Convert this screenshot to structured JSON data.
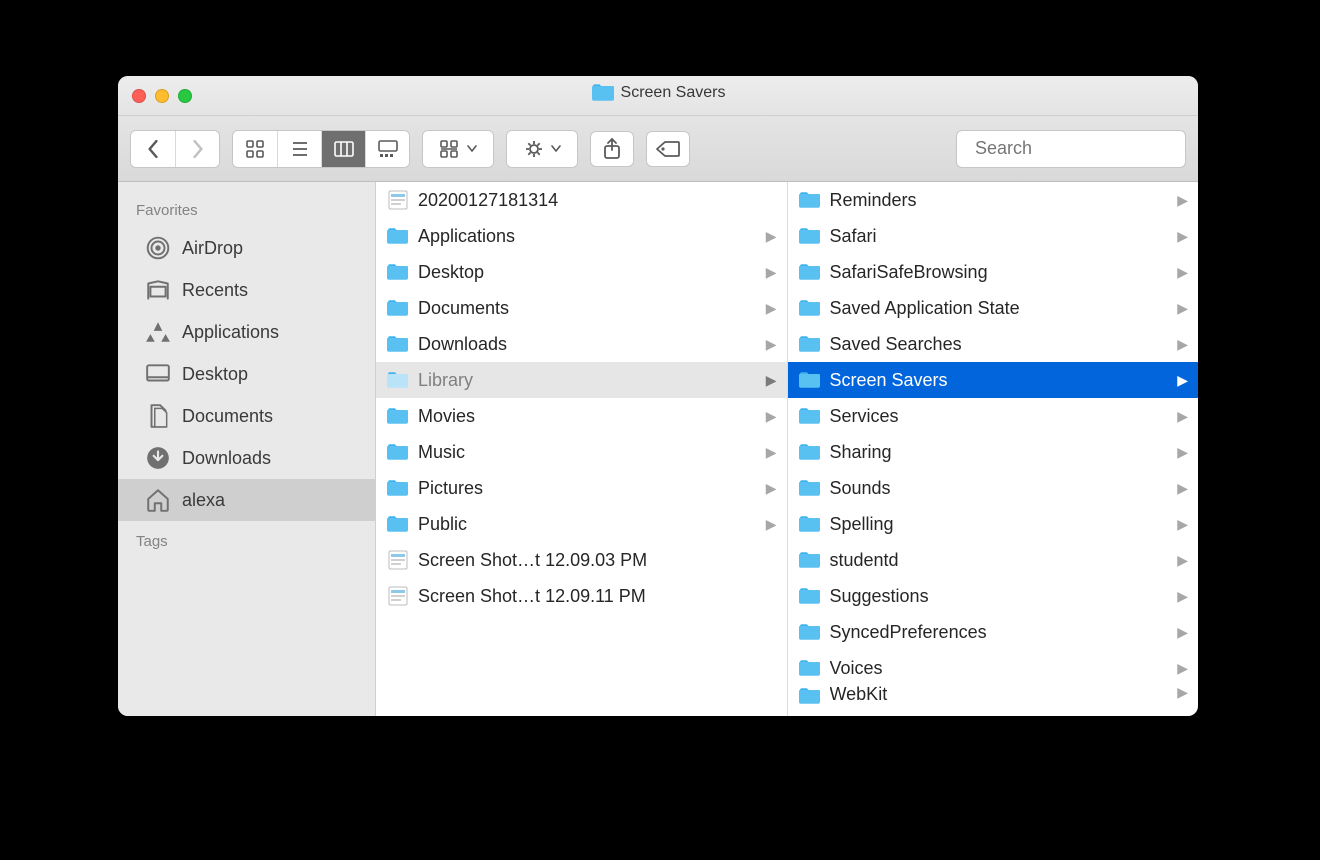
{
  "window": {
    "title": "Screen Savers",
    "titleIconColor": "#59c1f1"
  },
  "toolbar": {
    "searchPlaceholder": "Search"
  },
  "sidebar": {
    "sections": [
      {
        "header": "Favorites",
        "items": [
          {
            "icon": "airdrop",
            "label": "AirDrop",
            "name": "sidebar-item-airdrop"
          },
          {
            "icon": "recents",
            "label": "Recents",
            "name": "sidebar-item-recents"
          },
          {
            "icon": "apps",
            "label": "Applications",
            "name": "sidebar-item-applications"
          },
          {
            "icon": "desktop",
            "label": "Desktop",
            "name": "sidebar-item-desktop"
          },
          {
            "icon": "documents",
            "label": "Documents",
            "name": "sidebar-item-documents"
          },
          {
            "icon": "downloads",
            "label": "Downloads",
            "name": "sidebar-item-downloads"
          },
          {
            "icon": "home",
            "label": "alexa",
            "name": "sidebar-item-alexa",
            "selected": true
          }
        ]
      },
      {
        "header": "Tags",
        "items": []
      }
    ]
  },
  "columns": [
    {
      "name": "column-home",
      "items": [
        {
          "type": "file",
          "label": "20200127181314",
          "name": "item-20200127181314"
        },
        {
          "type": "folder",
          "label": "Applications",
          "arrow": true,
          "name": "item-applications"
        },
        {
          "type": "folder",
          "label": "Desktop",
          "arrow": true,
          "name": "item-desktop"
        },
        {
          "type": "folder",
          "label": "Documents",
          "arrow": true,
          "name": "item-documents"
        },
        {
          "type": "folder",
          "label": "Downloads",
          "arrow": true,
          "name": "item-downloads"
        },
        {
          "type": "folder",
          "label": "Library",
          "arrow": true,
          "name": "item-library",
          "state": "open"
        },
        {
          "type": "folder",
          "label": "Movies",
          "arrow": true,
          "name": "item-movies"
        },
        {
          "type": "folder",
          "label": "Music",
          "arrow": true,
          "name": "item-music"
        },
        {
          "type": "folder",
          "label": "Pictures",
          "arrow": true,
          "name": "item-pictures"
        },
        {
          "type": "folder",
          "label": "Public",
          "arrow": true,
          "name": "item-public"
        },
        {
          "type": "file",
          "label": "Screen Shot…t 12.09.03 PM",
          "name": "item-screenshot-1"
        },
        {
          "type": "file",
          "label": "Screen Shot…t 12.09.11 PM",
          "name": "item-screenshot-2"
        }
      ]
    },
    {
      "name": "column-library",
      "items": [
        {
          "type": "folder",
          "label": "Reminders",
          "arrow": true,
          "name": "item-reminders"
        },
        {
          "type": "folder",
          "label": "Safari",
          "arrow": true,
          "name": "item-safari"
        },
        {
          "type": "folder",
          "label": "SafariSafeBrowsing",
          "arrow": true,
          "name": "item-safarisafebrowsing"
        },
        {
          "type": "folder",
          "label": "Saved Application State",
          "arrow": true,
          "name": "item-saved-application-state"
        },
        {
          "type": "folder",
          "label": "Saved Searches",
          "arrow": true,
          "name": "item-saved-searches"
        },
        {
          "type": "folder",
          "label": "Screen Savers",
          "arrow": true,
          "name": "item-screen-savers",
          "state": "active"
        },
        {
          "type": "folder",
          "label": "Services",
          "arrow": true,
          "name": "item-services"
        },
        {
          "type": "folder",
          "label": "Sharing",
          "arrow": true,
          "name": "item-sharing"
        },
        {
          "type": "folder",
          "label": "Sounds",
          "arrow": true,
          "name": "item-sounds"
        },
        {
          "type": "folder",
          "label": "Spelling",
          "arrow": true,
          "name": "item-spelling"
        },
        {
          "type": "folder",
          "label": "studentd",
          "arrow": true,
          "name": "item-studentd"
        },
        {
          "type": "folder",
          "label": "Suggestions",
          "arrow": true,
          "name": "item-suggestions"
        },
        {
          "type": "folder",
          "label": "SyncedPreferences",
          "arrow": true,
          "name": "item-syncedpreferences"
        },
        {
          "type": "folder",
          "label": "Voices",
          "arrow": true,
          "name": "item-voices"
        },
        {
          "type": "folder",
          "label": "WebKit",
          "arrow": true,
          "name": "item-webkit",
          "partial": true
        }
      ]
    }
  ]
}
